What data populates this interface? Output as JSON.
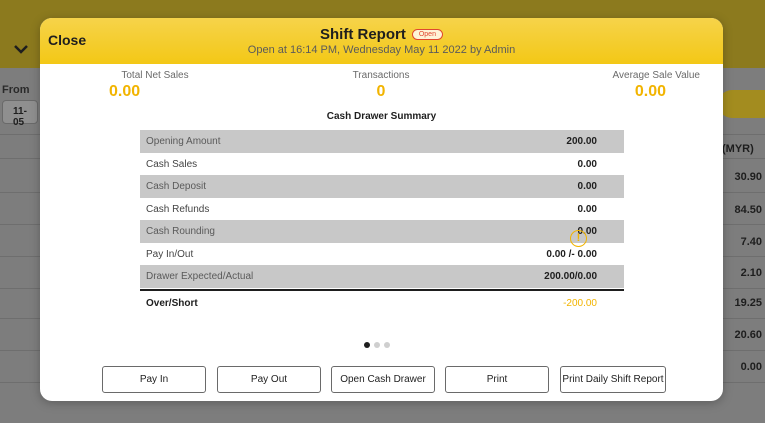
{
  "background": {
    "from_label": "From",
    "date_value": "11-05",
    "column_header": "(MYR)",
    "values": [
      "30.90",
      "84.50",
      "7.40",
      "2.10",
      "19.25",
      "20.60",
      "0.00"
    ]
  },
  "modal": {
    "close_label": "Close",
    "title": "Shift Report",
    "status_badge": "Open",
    "subtitle": "Open at 16:14 PM, Wednesday May 11 2022 by Admin",
    "stats": {
      "total_net_sales": {
        "label": "Total Net Sales",
        "value": "0.00"
      },
      "transactions": {
        "label": "Transactions",
        "value": "0"
      },
      "average_sale_value": {
        "label": "Average Sale Value",
        "value": "0.00"
      }
    },
    "summary_title": "Cash Drawer Summary",
    "rows": [
      {
        "label": "Opening Amount",
        "value": "200.00"
      },
      {
        "label": "Cash Sales",
        "value": "0.00"
      },
      {
        "label": "Cash Deposit",
        "value": "0.00"
      },
      {
        "label": "Cash Refunds",
        "value": "0.00"
      },
      {
        "label": "Cash Rounding",
        "value": "0.00"
      },
      {
        "label": "Pay In/Out",
        "value": "0.00 /- 0.00"
      },
      {
        "label": "Drawer Expected/Actual",
        "value": "200.00/0.00"
      }
    ],
    "over_short": {
      "label": "Over/Short",
      "value": "-200.00"
    },
    "buttons": {
      "pay_in": "Pay In",
      "pay_out": "Pay Out",
      "open_cash_drawer": "Open Cash Drawer",
      "print": "Print",
      "print_daily": "Print Daily Shift Report"
    },
    "colors": {
      "accent": "#f2b400",
      "header": "#f3c816",
      "badge": "#e0482f"
    }
  }
}
